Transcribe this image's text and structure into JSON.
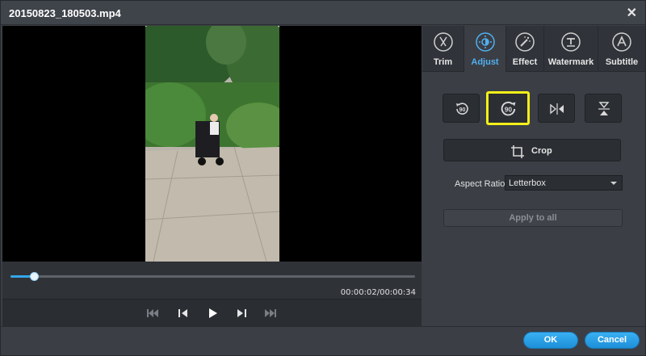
{
  "window": {
    "title": "20150823_180503.mp4"
  },
  "tabs": [
    {
      "label": "Trim",
      "icon": "scissors-icon"
    },
    {
      "label": "Adjust",
      "icon": "brightness-icon",
      "active": true
    },
    {
      "label": "Effect",
      "icon": "magic-wand-icon"
    },
    {
      "label": "Watermark",
      "icon": "watermark-icon"
    },
    {
      "label": "Subtitle",
      "icon": "subtitle-icon"
    }
  ],
  "adjust": {
    "rotate_left_label": "90",
    "rotate_right_label": "90",
    "crop_label": "Crop",
    "aspect_ratio_label": "Aspect Ratio:",
    "aspect_ratio_value": "Letterbox",
    "apply_all_label": "Apply to all"
  },
  "player": {
    "timecode": "00:00:02/00:00:34",
    "progress": 0.058
  },
  "footer": {
    "ok_label": "OK",
    "cancel_label": "Cancel"
  },
  "colors": {
    "accent": "#35a6e8",
    "highlight": "#f4ef19",
    "active_tab_text": "#51b0f0"
  }
}
